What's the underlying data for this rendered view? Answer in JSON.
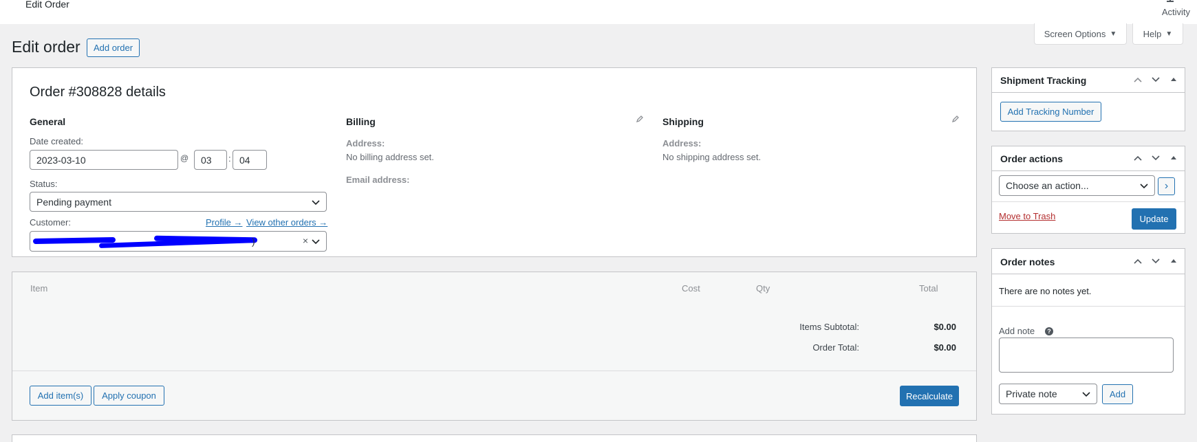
{
  "topbar": {
    "title": "Edit Order",
    "activity": "Activity"
  },
  "screen_options": "Screen Options",
  "help": "Help",
  "heading": "Edit order",
  "add_order": "Add order",
  "order": {
    "title": "Order #308828 details",
    "general": {
      "heading": "General",
      "date_label": "Date created:",
      "date_value": "2023-03-10",
      "at_symbol": "@",
      "hour": "03",
      "colon": ":",
      "minute": "04",
      "status_label": "Status:",
      "status_value": "Pending payment",
      "customer_label": "Customer:",
      "profile_link": "Profile →",
      "other_orders_link": "View other orders →",
      "customer_value_tail": ")",
      "clear_symbol": "×"
    },
    "billing": {
      "heading": "Billing",
      "address_label": "Address:",
      "address_value": "No billing address set.",
      "email_label": "Email address:"
    },
    "shipping": {
      "heading": "Shipping",
      "address_label": "Address:",
      "address_value": "No shipping address set."
    }
  },
  "items": {
    "columns": [
      "Item",
      "Cost",
      "Qty",
      "Total"
    ],
    "subtotal_label": "Items Subtotal:",
    "subtotal_value": "$0.00",
    "total_label": "Order Total:",
    "total_value": "$0.00",
    "add_items": "Add item(s)",
    "apply_coupon": "Apply coupon",
    "recalculate": "Recalculate"
  },
  "sidebar": {
    "shipment": {
      "title": "Shipment Tracking",
      "button": "Add Tracking Number"
    },
    "actions": {
      "title": "Order actions",
      "select_value": "Choose an action...",
      "go": "›",
      "trash": "Move to Trash",
      "update": "Update"
    },
    "notes": {
      "title": "Order notes",
      "empty": "There are no notes yet.",
      "add_note_label": "Add note",
      "help": "?",
      "type_value": "Private note",
      "add_button": "Add"
    }
  },
  "colors": {
    "accent": "#2271b1",
    "danger": "#b32d2e",
    "redaction": "#0000ff"
  }
}
